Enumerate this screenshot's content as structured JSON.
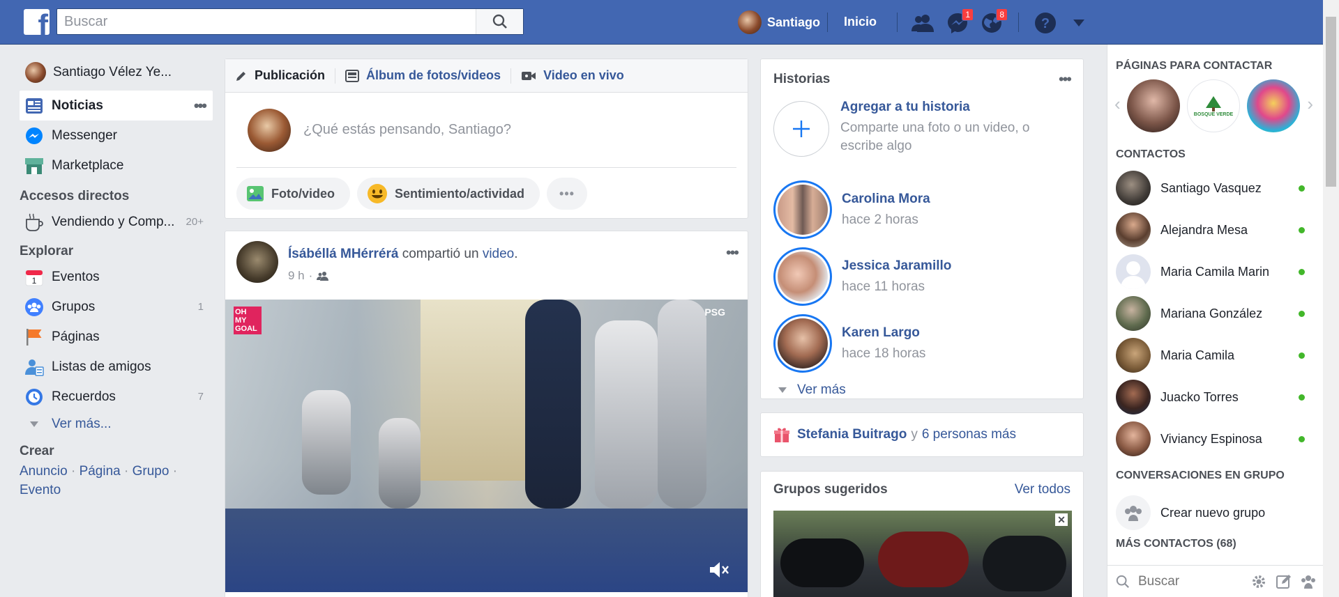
{
  "topbar": {
    "logo": "f",
    "search_placeholder": "Buscar",
    "user_name": "Santiago",
    "home_label": "Inicio",
    "messages_badge": "1",
    "notifications_badge": "8",
    "help_icon": "?"
  },
  "left_nav": {
    "profile_name": "Santiago Vélez Ye...",
    "main_items": [
      {
        "label": "Noticias",
        "icon": "news-feed-icon"
      },
      {
        "label": "Messenger",
        "icon": "messenger-icon"
      },
      {
        "label": "Marketplace",
        "icon": "marketplace-icon"
      }
    ],
    "shortcuts_title": "Accesos directos",
    "shortcut": {
      "label": "Vendiendo y Comp...",
      "count": "20+"
    },
    "explore_title": "Explorar",
    "explore_items": [
      {
        "label": "Eventos",
        "count": ""
      },
      {
        "label": "Grupos",
        "count": "1"
      },
      {
        "label": "Páginas",
        "count": ""
      },
      {
        "label": "Listas de amigos",
        "count": ""
      },
      {
        "label": "Recuerdos",
        "count": "7"
      }
    ],
    "see_more": "Ver más...",
    "create_title": "Crear",
    "create_links": [
      "Anuncio",
      "Página",
      "Grupo",
      "Evento"
    ],
    "calendar_day": "1"
  },
  "composer": {
    "tab_post": "Publicación",
    "tab_album": "Álbum de fotos/videos",
    "tab_live": "Video en vivo",
    "placeholder": "¿Qué estás pensando, Santiago?",
    "btn_photo": "Foto/video",
    "btn_feeling": "Sentimiento/actividad",
    "btn_more": "•••"
  },
  "post": {
    "author": "Ísábéllá MHérrérá",
    "action_prefix": "compartió un",
    "action_link": "video",
    "time": "9 h",
    "video_badge_left": "OH MY GOAL",
    "video_badge_right": "PSG"
  },
  "stories": {
    "title": "Historias",
    "add_title": "Agregar a tu historia",
    "add_subtitle": "Comparte una foto o un video, o escribe algo",
    "items": [
      {
        "name": "Carolina Mora",
        "time": "hace 2 horas"
      },
      {
        "name": "Jessica Jaramillo",
        "time": "hace 11 horas"
      },
      {
        "name": "Karen Largo",
        "time": "hace 18 horas"
      }
    ],
    "see_more": "Ver más"
  },
  "birthday": {
    "name": "Stefania Buitrago",
    "connector": "y",
    "others": "6 personas más"
  },
  "groups": {
    "title": "Grupos sugeridos",
    "see_all": "Ver todos"
  },
  "right_rail": {
    "pages_title": "PÁGINAS PARA CONTACTAR",
    "page_logo_text": "BOSQUE VERDE",
    "contacts_title": "CONTACTOS",
    "contacts": [
      "Santiago Vasquez",
      "Alejandra Mesa",
      "Maria Camila Marin",
      "Mariana González",
      "Maria Camila",
      "Juacko Torres",
      "Viviancy Espinosa"
    ],
    "group_conv_title": "CONVERSACIONES EN GRUPO",
    "create_group": "Crear nuevo grupo",
    "more_contacts": "MÁS CONTACTOS (68)",
    "search_placeholder": "Buscar"
  },
  "colors": {
    "brand": "#4267b2",
    "link": "#365899",
    "online": "#42b72a",
    "badge": "#fa3e3e"
  }
}
